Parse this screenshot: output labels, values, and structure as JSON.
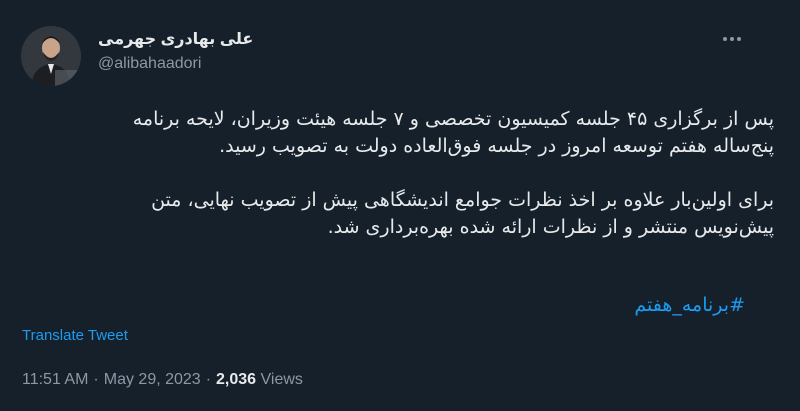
{
  "user": {
    "display_name": "علی بهادری جهرمی",
    "handle": "@alibahaadori"
  },
  "tweet": {
    "paragraphs": [
      [
        "پس از برگزاری ۴۵ جلسه کمیسیون تخصصی و ۷ جلسه هیئت وزیران، لایحه برنامه",
        "پنج‌ساله هفتم توسعه امروز در جلسه فوق‌العاده دولت به تصویب رسید."
      ],
      [
        "برای اولین‌بار علاوه بر اخذ نظرات جوامع اندیشگاهی پیش از تصویب نهایی، متن",
        "پیش‌نویس منتشر و از نظرات ارائه شده بهره‌برداری شد."
      ]
    ],
    "hashtag": "#برنامه_هفتم",
    "translate_label": "Translate Tweet",
    "time": "11:51 AM",
    "date": "May 29, 2023",
    "views_count": "2,036",
    "views_label": "Views"
  },
  "icons": {
    "more": "more-horizontal-icon",
    "avatar": "avatar-photo"
  },
  "colors": {
    "background": "#15202b",
    "text_primary": "#e7e9ea",
    "text_secondary": "#8b98a5",
    "link": "#1d9bf0"
  }
}
